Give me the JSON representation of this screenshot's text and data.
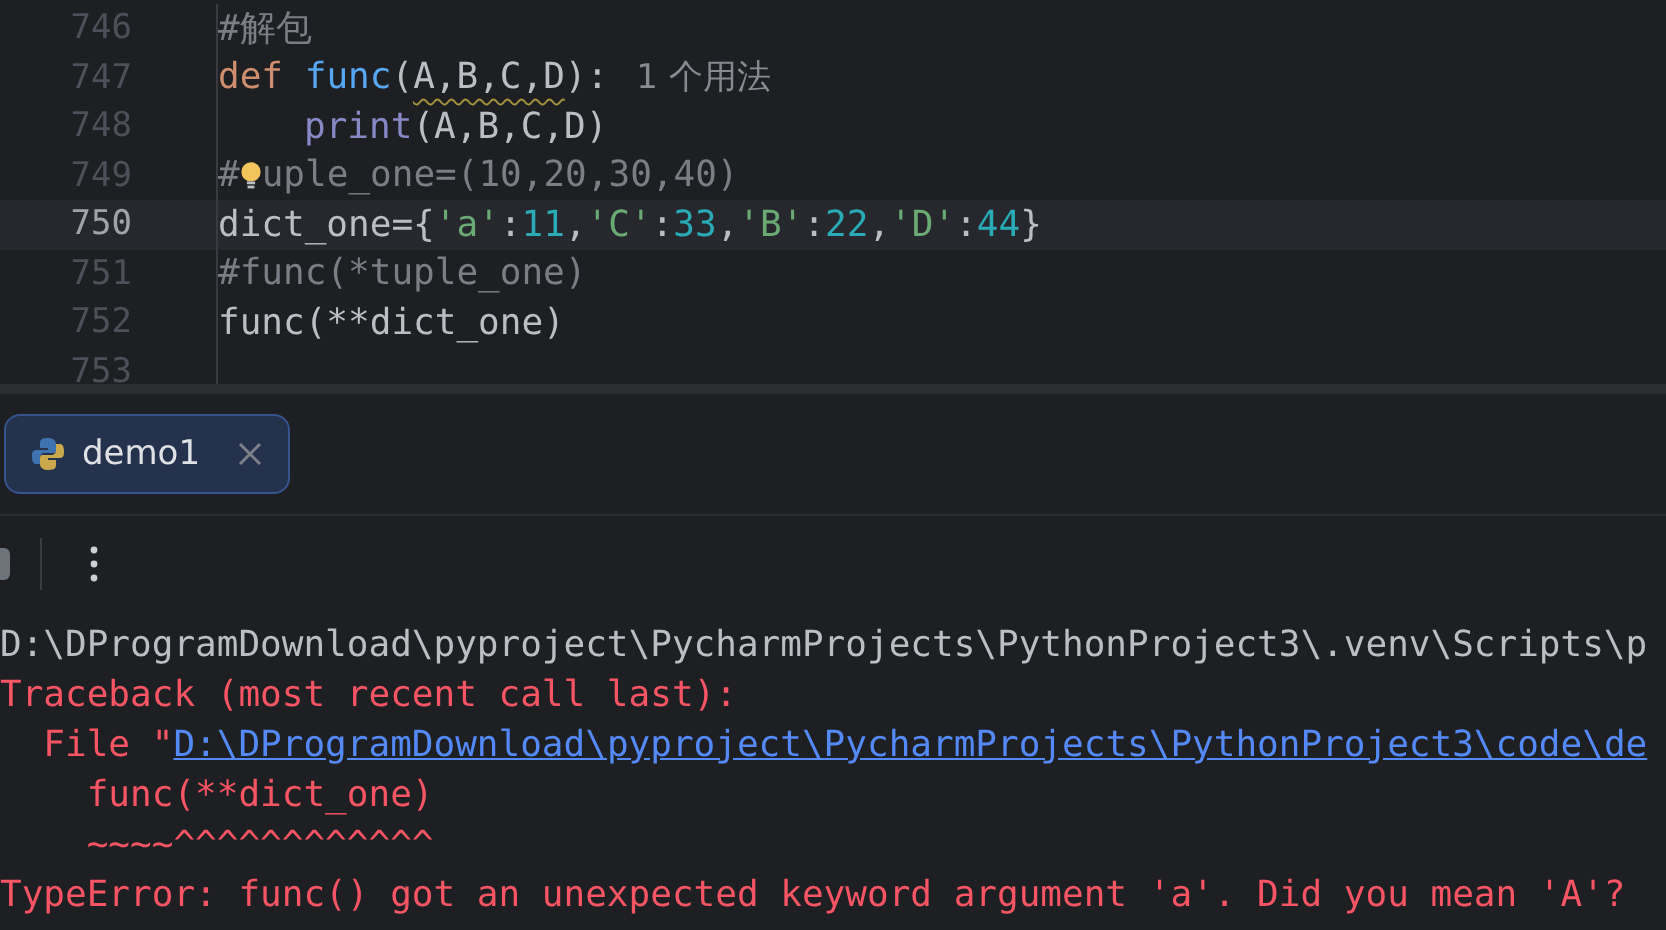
{
  "editor": {
    "lines": [
      {
        "number": "746",
        "current": false,
        "indented": false,
        "tokens": [
          {
            "kind": "comment",
            "text": "#解包"
          }
        ]
      },
      {
        "number": "747",
        "current": false,
        "indented": false,
        "tokens": [
          {
            "kind": "keyword",
            "text": "def "
          },
          {
            "kind": "func",
            "text": "func"
          },
          {
            "kind": "plain",
            "text": "("
          },
          {
            "kind": "warned",
            "text": "A,B,C,D"
          },
          {
            "kind": "plain",
            "text": "):"
          }
        ],
        "hint": "1 个用法"
      },
      {
        "number": "748",
        "current": false,
        "indented": true,
        "tokens": [
          {
            "kind": "builtin",
            "text": "print"
          },
          {
            "kind": "plain",
            "text": "(A,B,C,D)"
          }
        ]
      },
      {
        "number": "749",
        "current": false,
        "indented": false,
        "tokens": [
          {
            "kind": "comment",
            "text": "#"
          },
          {
            "kind": "bulb"
          },
          {
            "kind": "comment",
            "text": "uple_one=(10,20,30,40)"
          }
        ]
      },
      {
        "number": "750",
        "current": true,
        "indented": false,
        "tokens": [
          {
            "kind": "plain",
            "text": "dict_one={"
          },
          {
            "kind": "string",
            "text": "'a'"
          },
          {
            "kind": "plain",
            "text": ":"
          },
          {
            "kind": "number",
            "text": "11"
          },
          {
            "kind": "plain",
            "text": ","
          },
          {
            "kind": "string",
            "text": "'C'"
          },
          {
            "kind": "plain",
            "text": ":"
          },
          {
            "kind": "number",
            "text": "33"
          },
          {
            "kind": "plain",
            "text": ","
          },
          {
            "kind": "string",
            "text": "'B'"
          },
          {
            "kind": "plain",
            "text": ":"
          },
          {
            "kind": "number",
            "text": "22"
          },
          {
            "kind": "plain",
            "text": ","
          },
          {
            "kind": "string",
            "text": "'D'"
          },
          {
            "kind": "plain",
            "text": ":"
          },
          {
            "kind": "number",
            "text": "44"
          },
          {
            "kind": "plain",
            "text": "}"
          }
        ]
      },
      {
        "number": "751",
        "current": false,
        "indented": false,
        "tokens": [
          {
            "kind": "comment",
            "text": "#func(*tuple_one)"
          }
        ]
      },
      {
        "number": "752",
        "current": false,
        "indented": false,
        "tokens": [
          {
            "kind": "plain",
            "text": "func(**dict_one)"
          }
        ]
      },
      {
        "number": "753",
        "current": false
      }
    ]
  },
  "run_tabs": [
    {
      "label": "demo1",
      "selected": true
    }
  ],
  "console": {
    "lines": [
      {
        "kind": "output",
        "segments": [
          {
            "kind": "plain",
            "text": "D:\\DProgramDownload\\pyproject\\PycharmProjects\\PythonProject3\\.venv\\Scripts\\p"
          }
        ]
      },
      {
        "kind": "error",
        "segments": [
          {
            "kind": "plain",
            "text": "Traceback (most recent call last):"
          }
        ]
      },
      {
        "kind": "error",
        "segments": [
          {
            "kind": "plain",
            "text": "  File \""
          },
          {
            "kind": "link",
            "text": "D:\\DProgramDownload\\pyproject\\PycharmProjects\\PythonProject3\\code\\de"
          }
        ]
      },
      {
        "kind": "error",
        "segments": [
          {
            "kind": "plain",
            "text": "    func(**dict_one)"
          }
        ]
      },
      {
        "kind": "error",
        "segments": [
          {
            "kind": "plain",
            "text": "    ~~~~^^^^^^^^^^^^"
          }
        ]
      },
      {
        "kind": "error",
        "segments": [
          {
            "kind": "plain",
            "text": "TypeError: func() got an unexpected keyword argument 'a'. Did you mean 'A'?"
          }
        ]
      }
    ]
  }
}
